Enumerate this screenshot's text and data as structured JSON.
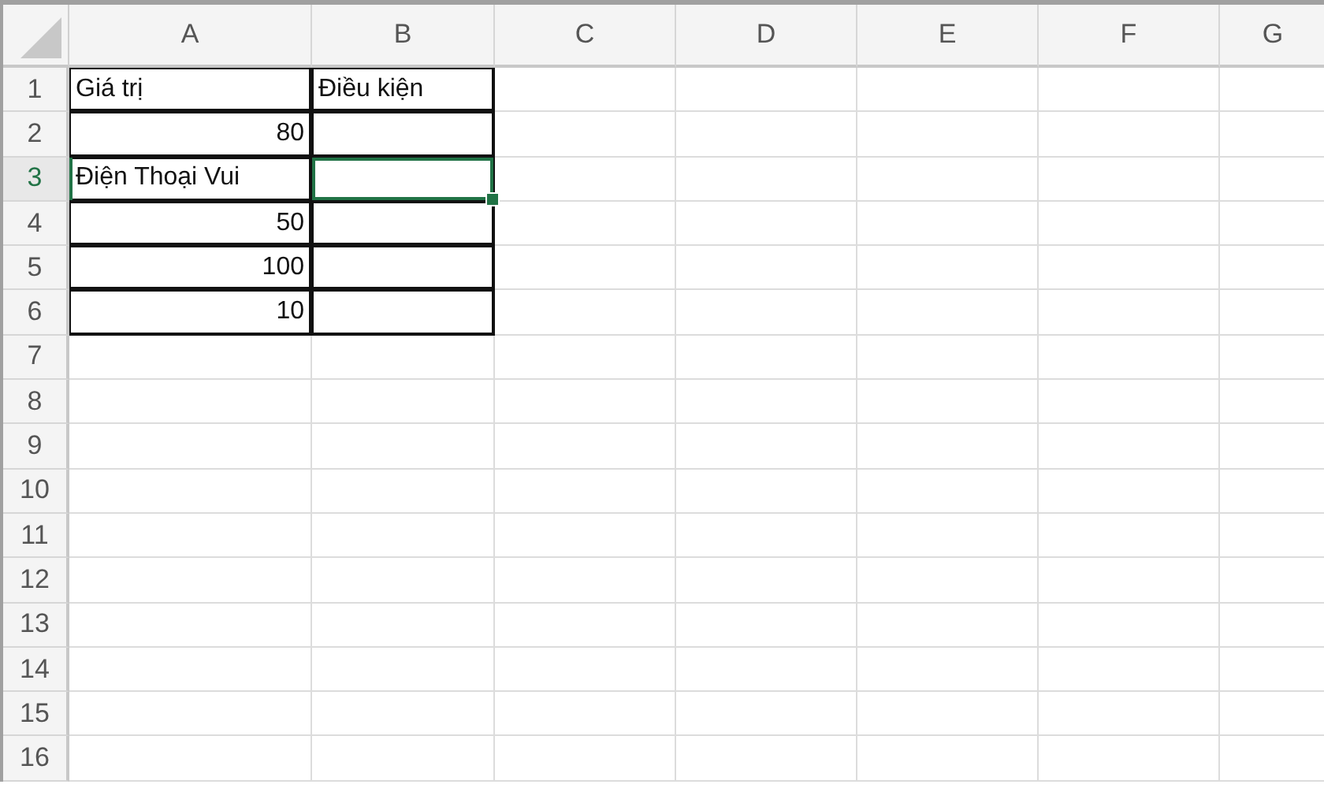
{
  "columns": [
    {
      "label": "A"
    },
    {
      "label": "B"
    },
    {
      "label": "C"
    },
    {
      "label": "D"
    },
    {
      "label": "E"
    },
    {
      "label": "F"
    },
    {
      "label": "G"
    }
  ],
  "rows": [
    {
      "number": "1",
      "selected": false,
      "cells": [
        {
          "kind": "text",
          "text": "Giá trị",
          "bordered": true,
          "selected": false
        },
        {
          "kind": "text",
          "text": "Điều kiện",
          "bordered": true,
          "selected": false
        }
      ]
    },
    {
      "number": "2",
      "selected": false,
      "cells": [
        {
          "kind": "number",
          "text": "80",
          "bordered": true,
          "selected": false
        },
        {
          "kind": "text",
          "bordered": true,
          "selected": false
        }
      ]
    },
    {
      "number": "3",
      "selected": true,
      "cells": [
        {
          "kind": "text",
          "text": "Điện Thoại Vui",
          "bordered": true,
          "selected": false
        },
        {
          "kind": "text",
          "bordered": true,
          "selected": true
        }
      ]
    },
    {
      "number": "4",
      "selected": false,
      "cells": [
        {
          "kind": "number",
          "text": "50",
          "bordered": true,
          "selected": false
        },
        {
          "kind": "text",
          "bordered": true,
          "selected": false
        }
      ]
    },
    {
      "number": "5",
      "selected": false,
      "cells": [
        {
          "kind": "number",
          "text": "100",
          "bordered": true,
          "selected": false
        },
        {
          "kind": "text",
          "bordered": true,
          "selected": false
        }
      ]
    },
    {
      "number": "6",
      "selected": false,
      "cells": [
        {
          "kind": "number",
          "text": "10",
          "bordered": true,
          "selected": false
        },
        {
          "kind": "text",
          "bordered": true,
          "selected": false
        }
      ]
    },
    {
      "number": "7",
      "selected": false
    },
    {
      "number": "8",
      "selected": false
    },
    {
      "number": "9",
      "selected": false
    },
    {
      "number": "10",
      "selected": false
    },
    {
      "number": "11",
      "selected": false
    },
    {
      "number": "12",
      "selected": false
    },
    {
      "number": "13",
      "selected": false
    },
    {
      "number": "14",
      "selected": false
    },
    {
      "number": "15",
      "selected": false
    },
    {
      "number": "16",
      "selected": false
    }
  ]
}
